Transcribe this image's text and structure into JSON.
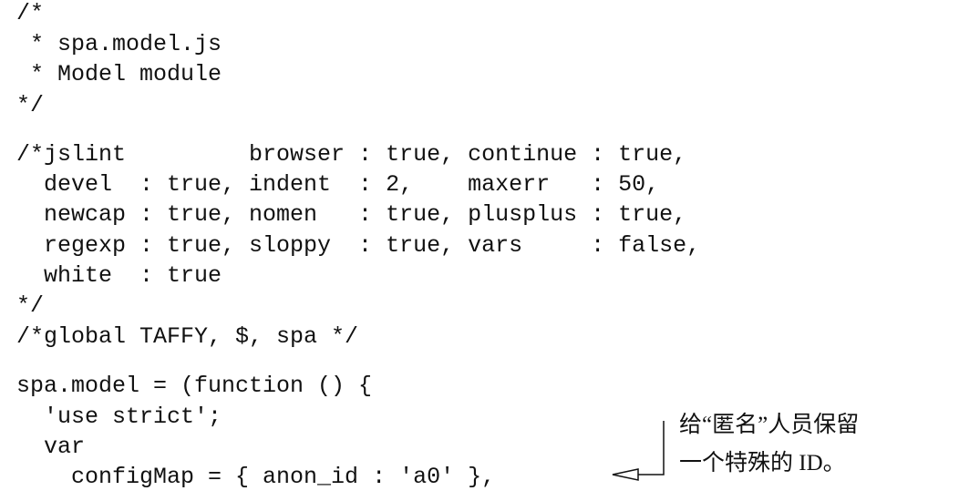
{
  "code": {
    "lines": [
      "/*",
      " * spa.model.js",
      " * Model module",
      "*/",
      "/*jslint         browser : true, continue : true,",
      "  devel  : true, indent  : 2,    maxerr   : 50,",
      "  newcap : true, nomen   : true, plusplus : true,",
      "  regexp : true, sloppy  : true, vars     : false,",
      "  white  : true",
      "*/",
      "/*global TAFFY, $, spa */",
      "spa.model = (function () {",
      "  'use strict';",
      "  var",
      "    configMap = { anon_id : 'a0' },"
    ]
  },
  "annotation": {
    "line1": "给“匿名”人员保留",
    "line2": "一个特殊的 ID。"
  }
}
